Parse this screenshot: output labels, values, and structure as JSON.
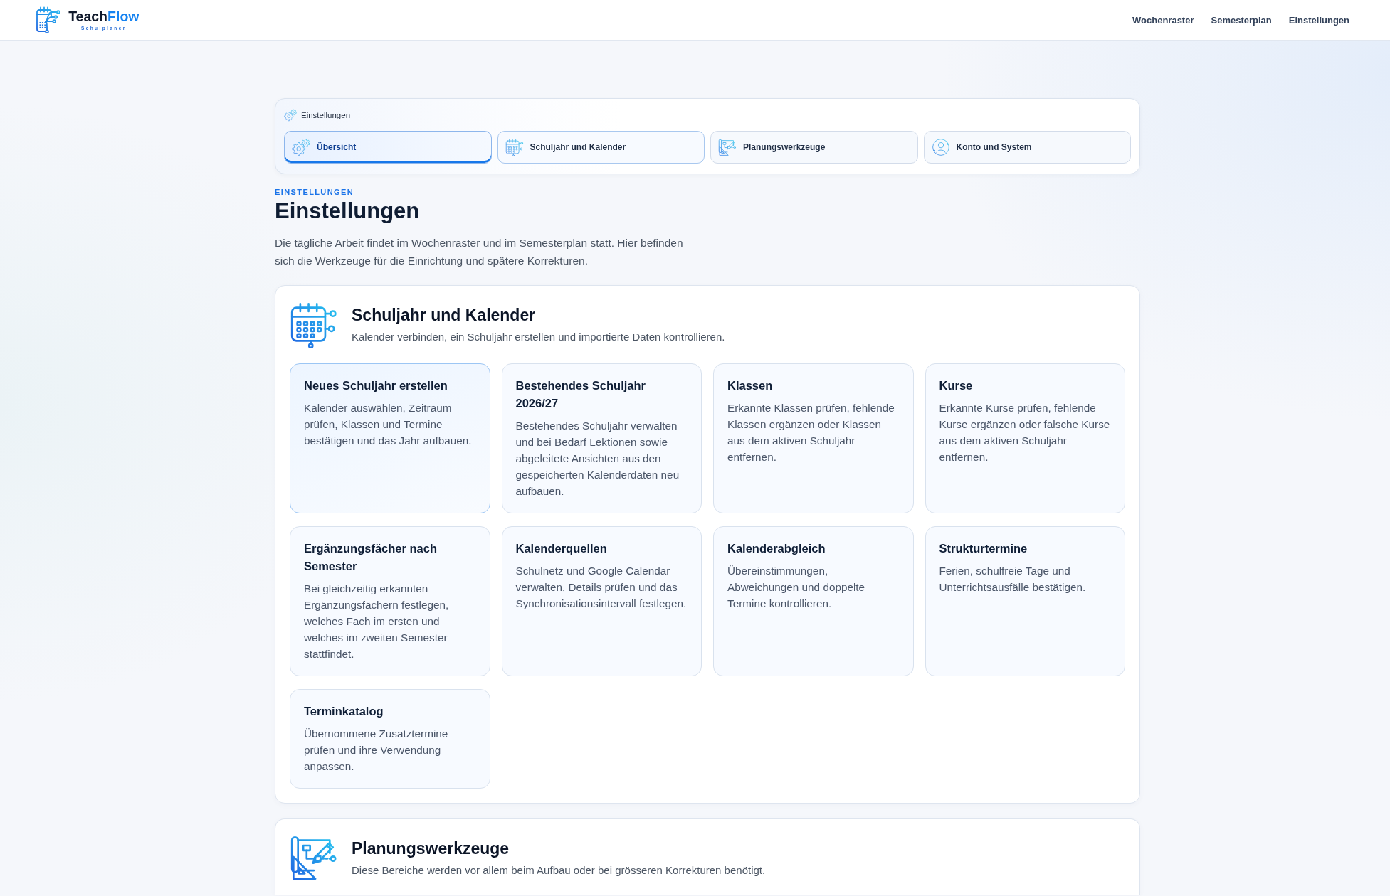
{
  "header": {
    "brand": {
      "name": "Teach",
      "name_accent": "Flow",
      "tagline": "Schulplaner"
    },
    "nav": [
      "Wochenraster",
      "Semesterplan",
      "Einstellungen"
    ]
  },
  "settings_nav": {
    "label": "Einstellungen",
    "tabs": [
      {
        "kind": "overview",
        "label": "Übersicht",
        "selected": true,
        "highlighted": false
      },
      {
        "kind": "calendar",
        "label": "Schuljahr und Kalender",
        "selected": false,
        "highlighted": true
      },
      {
        "kind": "tools",
        "label": "Planungswerkzeuge",
        "selected": false,
        "highlighted": false
      },
      {
        "kind": "account",
        "label": "Konto und System",
        "selected": false,
        "highlighted": false
      }
    ]
  },
  "page": {
    "eyebrow": "EINSTELLUNGEN",
    "title": "Einstellungen",
    "intro": "Die tägliche Arbeit findet im Wochenraster und im Semesterplan statt. Hier befinden sich die Werkzeuge für die Einrichtung und spätere Korrekturen."
  },
  "sections": [
    {
      "kind": "calendar",
      "title": "Schuljahr und Kalender",
      "subtitle": "Kalender verbinden, ein Schuljahr erstellen und importierte Daten kontrollieren.",
      "cards": [
        {
          "title": "Neues Schuljahr erstellen",
          "description": "Kalender auswählen, Zeitraum prüfen, Klassen und Termine bestätigen und das Jahr aufbauen.",
          "selected": true
        },
        {
          "title": "Bestehendes Schuljahr 2026/27",
          "description": "Bestehendes Schuljahr verwalten und bei Bedarf Lektionen sowie abgeleitete Ansichten aus den gespeicherten Kalenderdaten neu aufbauen.",
          "selected": false
        },
        {
          "title": "Klassen",
          "description": "Erkannte Klassen prüfen, fehlende Klassen ergänzen oder Klassen aus dem aktiven Schuljahr entfernen.",
          "selected": false
        },
        {
          "title": "Kurse",
          "description": "Erkannte Kurse prüfen, fehlende Kurse ergänzen oder falsche Kurse aus dem aktiven Schuljahr entfernen.",
          "selected": false
        },
        {
          "title": "Ergänzungsfächer nach Semester",
          "description": "Bei gleichzeitig erkannten Ergänzungsfächern festlegen, welches Fach im ersten und welches im zweiten Semester stattfindet.",
          "selected": false
        },
        {
          "title": "Kalenderquellen",
          "description": "Schulnetz und Google Calendar verwalten, Details prüfen und das Synchronisationsintervall festlegen.",
          "selected": false
        },
        {
          "title": "Kalenderabgleich",
          "description": "Übereinstimmungen, Abweichungen und doppelte Termine kontrollieren.",
          "selected": false
        },
        {
          "title": "Strukturtermine",
          "description": "Ferien, schulfreie Tage und Unterrichtsausfälle bestätigen.",
          "selected": false
        },
        {
          "title": "Terminkatalog",
          "description": "Übernommene Zusatztermine prüfen und ihre Verwendung anpassen.",
          "selected": false
        }
      ]
    },
    {
      "kind": "tools",
      "title": "Planungswerkzeuge",
      "subtitle": "Diese Bereiche werden vor allem beim Aufbau oder bei grösseren Korrekturen benötigt."
    }
  ]
}
